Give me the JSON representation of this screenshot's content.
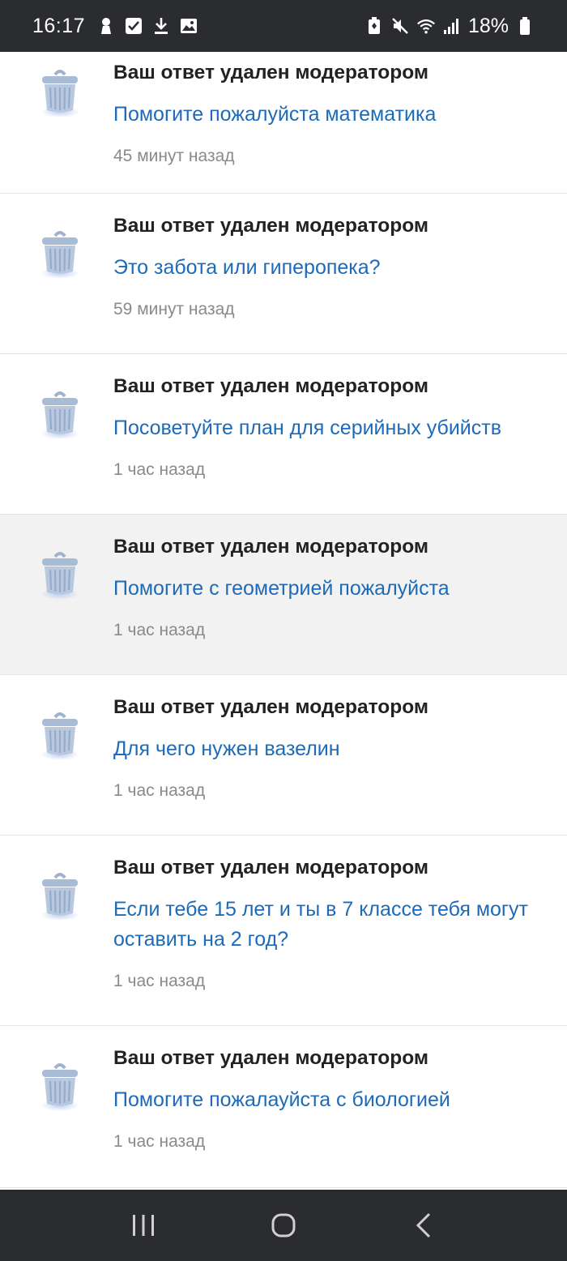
{
  "status_bar": {
    "time": "16:17",
    "battery": "18%",
    "left_icons": [
      "keyhole-icon",
      "checkbox-icon",
      "download-icon",
      "image-icon"
    ],
    "right_icons": [
      "battery-saver-icon",
      "mute-icon",
      "wifi-icon",
      "signal-icon",
      "battery-icon"
    ]
  },
  "notifications": [
    {
      "title": "Ваш ответ удален модератором",
      "question": "Помогите пожалуйста математика",
      "time": "45 минут назад",
      "highlighted": false
    },
    {
      "title": "Ваш ответ удален модератором",
      "question": "Это забота или гиперопека?",
      "time": "59 минут назад",
      "highlighted": false
    },
    {
      "title": "Ваш ответ удален модератором",
      "question": "Посоветуйте план для серийных убийств",
      "time": "1 час назад",
      "highlighted": false
    },
    {
      "title": "Ваш ответ удален модератором",
      "question": "Помогите с геометрией пожалуйста",
      "time": "1 час назад",
      "highlighted": true
    },
    {
      "title": "Ваш ответ удален модератором",
      "question": "Для чего нужен вазелин",
      "time": "1 час назад",
      "highlighted": false
    },
    {
      "title": "Ваш ответ удален модератором",
      "question": "Если тебе 15 лет и ты в 7 классе тебя могут оставить на 2 год?",
      "time": "1 час назад",
      "highlighted": false
    },
    {
      "title": "Ваш ответ удален модератором",
      "question": "Помогите пожалауйста с биологией",
      "time": "1 час назад",
      "highlighted": false
    }
  ],
  "nav_bar": {
    "buttons": [
      "recents-icon",
      "home-icon",
      "back-icon"
    ]
  },
  "colors": {
    "status_bar_bg": "#2b2c30",
    "title": "#222222",
    "link": "#1d6bb8",
    "timestamp": "#8a8a8a",
    "highlight_bg": "#f2f2f2",
    "trash_icon": "#a9bcd6"
  }
}
